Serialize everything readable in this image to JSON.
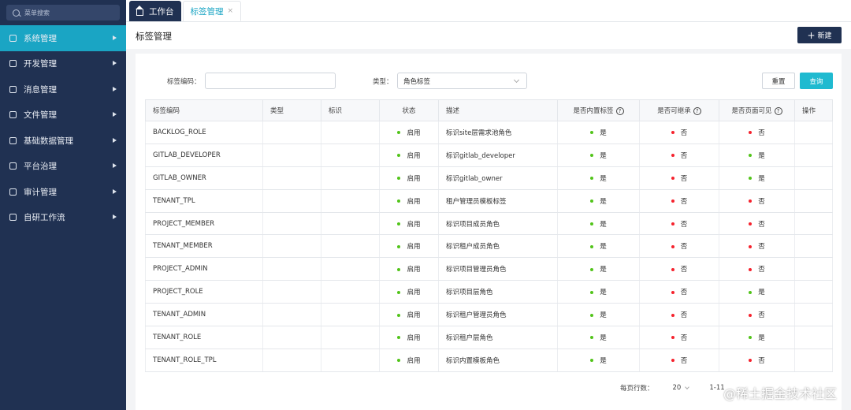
{
  "sidebar": {
    "search_placeholder": "菜单搜索",
    "items": [
      {
        "label": "系统管理",
        "active": true
      },
      {
        "label": "开发管理",
        "active": false
      },
      {
        "label": "消息管理",
        "active": false
      },
      {
        "label": "文件管理",
        "active": false
      },
      {
        "label": "基础数据管理",
        "active": false
      },
      {
        "label": "平台治理",
        "active": false
      },
      {
        "label": "审计管理",
        "active": false
      },
      {
        "label": "自研工作流",
        "active": false
      }
    ]
  },
  "tabs": [
    {
      "label": "工作台",
      "icon": "home-icon"
    },
    {
      "label": "标签管理",
      "close": "×"
    }
  ],
  "page": {
    "title": "标签管理",
    "new_button": "新建",
    "new_plus": "+"
  },
  "filters": {
    "code_label": "标签编码：",
    "code_value": "",
    "type_label": "类型：",
    "type_value": "角色标签",
    "reset_button": "重置",
    "query_button": "查询"
  },
  "table": {
    "headers": {
      "code": "标签编码",
      "type": "类型",
      "flag": "标识",
      "status": "状态",
      "desc": "描述",
      "builtin": "是否内置标签",
      "inherit": "是否可继承",
      "page_visible": "是否页面可见",
      "ops": "操作",
      "help": "?"
    },
    "rows": [
      {
        "code": "BACKLOG_ROLE",
        "type": "",
        "flag": "",
        "status": "启用",
        "desc": "标识site层需求池角色",
        "builtin": "是",
        "inherit": "否",
        "page_visible": "否"
      },
      {
        "code": "GITLAB_DEVELOPER",
        "type": "",
        "flag": "",
        "status": "启用",
        "desc": "标识gitlab_developer",
        "builtin": "是",
        "inherit": "否",
        "page_visible": "是"
      },
      {
        "code": "GITLAB_OWNER",
        "type": "",
        "flag": "",
        "status": "启用",
        "desc": "标识gitlab_owner",
        "builtin": "是",
        "inherit": "否",
        "page_visible": "是"
      },
      {
        "code": "TENANT_TPL",
        "type": "",
        "flag": "",
        "status": "启用",
        "desc": "租户管理员模板标签",
        "builtin": "是",
        "inherit": "否",
        "page_visible": "否"
      },
      {
        "code": "PROJECT_MEMBER",
        "type": "",
        "flag": "",
        "status": "启用",
        "desc": "标识项目成员角色",
        "builtin": "是",
        "inherit": "否",
        "page_visible": "否"
      },
      {
        "code": "TENANT_MEMBER",
        "type": "",
        "flag": "",
        "status": "启用",
        "desc": "标识租户成员角色",
        "builtin": "是",
        "inherit": "否",
        "page_visible": "否"
      },
      {
        "code": "PROJECT_ADMIN",
        "type": "",
        "flag": "",
        "status": "启用",
        "desc": "标识项目管理员角色",
        "builtin": "是",
        "inherit": "否",
        "page_visible": "否"
      },
      {
        "code": "PROJECT_ROLE",
        "type": "",
        "flag": "",
        "status": "启用",
        "desc": "标识项目层角色",
        "builtin": "是",
        "inherit": "否",
        "page_visible": "是"
      },
      {
        "code": "TENANT_ADMIN",
        "type": "",
        "flag": "",
        "status": "启用",
        "desc": "标识租户管理员角色",
        "builtin": "是",
        "inherit": "否",
        "page_visible": "否"
      },
      {
        "code": "TENANT_ROLE",
        "type": "",
        "flag": "",
        "status": "启用",
        "desc": "标识租户层角色",
        "builtin": "是",
        "inherit": "否",
        "page_visible": "是"
      },
      {
        "code": "TENANT_ROLE_TPL",
        "type": "",
        "flag": "",
        "status": "启用",
        "desc": "标识内置模板角色",
        "builtin": "是",
        "inherit": "否",
        "page_visible": "否"
      }
    ]
  },
  "pagination": {
    "rows_label": "每页行数：",
    "page_size": "20",
    "range": "1-11"
  },
  "watermark": "@稀土掘金技术社区",
  "colors": {
    "sidebar_bg": "#203152",
    "accent": "#1aa5c4",
    "yes_dot": "#52c41a",
    "no_dot": "#f5222d"
  }
}
